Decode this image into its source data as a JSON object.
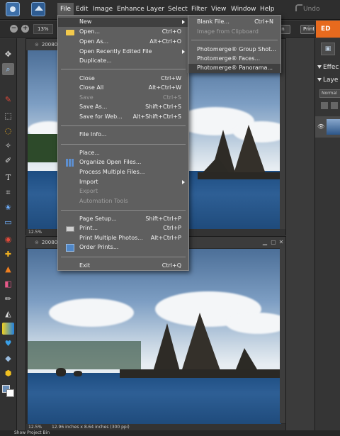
{
  "menubar": {
    "items": [
      "File",
      "Edit",
      "Image",
      "Enhance",
      "Layer",
      "Select",
      "Filter",
      "View",
      "Window",
      "Help"
    ],
    "undo_label": "Undo"
  },
  "options": {
    "zoom_value": "13%",
    "button_en": "en",
    "button_print": "Print",
    "edit_tab": "ED"
  },
  "documents": [
    {
      "title": "2008072",
      "zoom": "12.5%"
    },
    {
      "title": "2008072",
      "zoom": "12.5%",
      "status": "12.96 inches x 8.64 inches (300 ppi)"
    }
  ],
  "right_panel": {
    "effects_label": "Effec",
    "layers_label": "Laye",
    "blend_mode": "Normal"
  },
  "bottom_bar": {
    "label": "Show Project Bin"
  },
  "file_menu": {
    "items": [
      {
        "label": "New",
        "shortcut": "",
        "submenu": true,
        "disabled": false,
        "highlighted": true
      },
      {
        "label": "Open...",
        "shortcut": "Ctrl+O",
        "disabled": false,
        "icon": "folder-icon"
      },
      {
        "label": "Open As...",
        "shortcut": "Alt+Ctrl+O",
        "disabled": false
      },
      {
        "label": "Open Recently Edited File",
        "shortcut": "",
        "submenu": true,
        "disabled": false
      },
      {
        "label": "Duplicate...",
        "shortcut": "",
        "disabled": false
      },
      {
        "label": "Close",
        "shortcut": "Ctrl+W",
        "disabled": false
      },
      {
        "label": "Close All",
        "shortcut": "Alt+Ctrl+W",
        "disabled": false
      },
      {
        "label": "Save",
        "shortcut": "Ctrl+S",
        "disabled": true
      },
      {
        "label": "Save As...",
        "shortcut": "Shift+Ctrl+S",
        "disabled": false
      },
      {
        "label": "Save for Web...",
        "shortcut": "Alt+Shift+Ctrl+S",
        "disabled": false
      },
      {
        "label": "File Info...",
        "shortcut": "",
        "disabled": false
      },
      {
        "label": "Place...",
        "shortcut": "",
        "disabled": false
      },
      {
        "label": "Organize Open Files...",
        "shortcut": "",
        "disabled": false,
        "icon": "grid-icon"
      },
      {
        "label": "Process Multiple Files...",
        "shortcut": "",
        "disabled": false
      },
      {
        "label": "Import",
        "shortcut": "",
        "submenu": true,
        "disabled": false
      },
      {
        "label": "Export",
        "shortcut": "",
        "submenu": true,
        "disabled": true
      },
      {
        "label": "Automation Tools",
        "shortcut": "",
        "submenu": true,
        "disabled": true
      },
      {
        "label": "Page Setup...",
        "shortcut": "Shift+Ctrl+P",
        "disabled": false
      },
      {
        "label": "Print...",
        "shortcut": "Ctrl+P",
        "disabled": false,
        "icon": "printer-icon"
      },
      {
        "label": "Print Multiple Photos...",
        "shortcut": "Alt+Ctrl+P",
        "disabled": false
      },
      {
        "label": "Order Prints...",
        "shortcut": "",
        "disabled": false,
        "icon": "order-prints-icon"
      },
      {
        "label": "Exit",
        "shortcut": "Ctrl+Q",
        "disabled": false
      }
    ]
  },
  "new_submenu": {
    "items": [
      {
        "label": "Blank File...",
        "shortcut": "Ctrl+N",
        "disabled": false
      },
      {
        "label": "Image from Clipboard",
        "shortcut": "",
        "disabled": true
      },
      {
        "label": "Photomerge® Group Shot...",
        "shortcut": "",
        "disabled": false
      },
      {
        "label": "Photomerge® Faces...",
        "shortcut": "",
        "disabled": false
      },
      {
        "label": "Photomerge® Panorama...",
        "shortcut": "",
        "disabled": false,
        "highlighted": true
      }
    ]
  },
  "tools": [
    "move-tool-icon",
    "zoom-tool-icon",
    "eyedropper-tool-icon",
    "marquee-tool-icon",
    "lasso-tool-icon",
    "magic-wand-tool-icon",
    "quick-selection-tool-icon",
    "type-tool-icon",
    "crop-tool-icon",
    "cookie-cutter-tool-icon",
    "straighten-tool-icon",
    "red-eye-tool-icon",
    "healing-brush-tool-icon",
    "clone-stamp-tool-icon",
    "eraser-tool-icon",
    "brush-tool-icon",
    "smart-brush-tool-icon",
    "paint-bucket-tool-icon",
    "gradient-tool-icon",
    "shape-tool-icon",
    "blur-tool-icon",
    "sponge-tool-icon"
  ],
  "colors": {
    "accent": "#e76a1e",
    "menu_bg": "#5f5f5f",
    "highlight": "#404040"
  }
}
